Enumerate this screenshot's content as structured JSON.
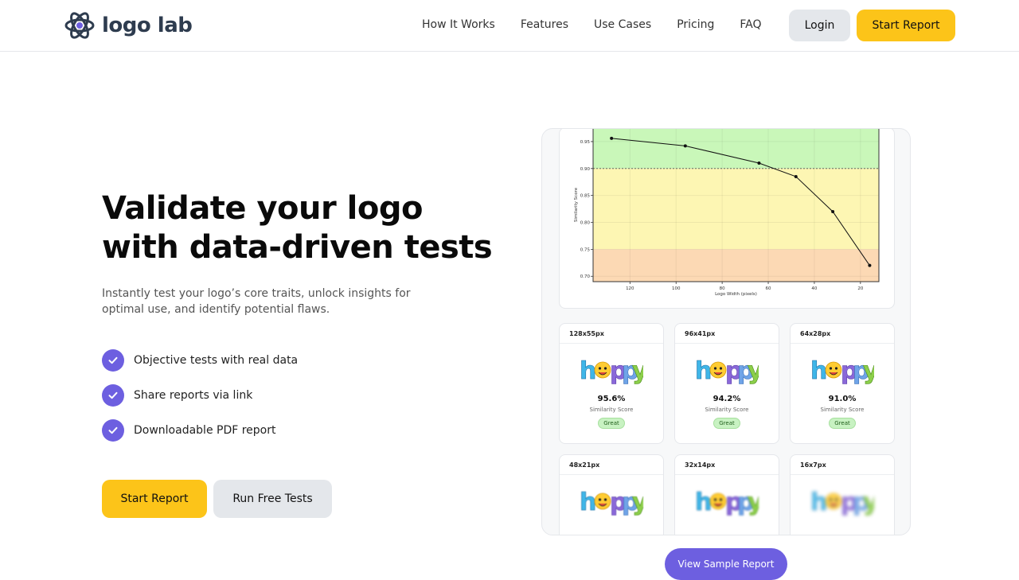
{
  "header": {
    "brand": "logo lab",
    "nav": [
      "How It Works",
      "Features",
      "Use Cases",
      "Pricing",
      "FAQ"
    ],
    "login_label": "Login",
    "start_label": "Start Report"
  },
  "hero": {
    "title_line1": "Validate your logo",
    "title_line2": "with data-driven tests",
    "subtitle": "Instantly test your logo’s core traits, unlock insights for optimal use, and identify potential flaws.",
    "features": [
      "Objective tests with real data",
      "Share reports via link",
      "Downloadable PDF report"
    ],
    "start_label": "Start Report",
    "run_label": "Run Free Tests"
  },
  "preview": {
    "sample_label": "View Sample Report",
    "logo_word": "happy",
    "cards": [
      {
        "size": "128x55px",
        "score": "95.6%",
        "score_label": "Similarity Score",
        "badge": "Great"
      },
      {
        "size": "96x41px",
        "score": "94.2%",
        "score_label": "Similarity Score",
        "badge": "Great"
      },
      {
        "size": "64x28px",
        "score": "91.0%",
        "score_label": "Similarity Score",
        "badge": "Great"
      },
      {
        "size": "48x21px",
        "score": "",
        "score_label": "",
        "badge": ""
      },
      {
        "size": "32x14px",
        "score": "",
        "score_label": "",
        "badge": ""
      },
      {
        "size": "16x7px",
        "score": "",
        "score_label": "",
        "badge": ""
      }
    ]
  },
  "colors": {
    "accent": "#6d5fe0",
    "cta": "#fcc419",
    "secondary": "#e4e7eb",
    "zone_green": "#c9f7b9",
    "zone_yellow": "#fdf6b3",
    "zone_orange": "#fcd9b4"
  },
  "chart_data": {
    "type": "line",
    "title": "",
    "xlabel": "Logo Width (pixels)",
    "ylabel": "Similarity Score",
    "x": [
      128,
      96,
      64,
      48,
      32,
      16
    ],
    "values": [
      0.956,
      0.942,
      0.91,
      0.885,
      0.82,
      0.72
    ],
    "x_ticks": [
      "120",
      "100",
      "80",
      "60",
      "40",
      "20"
    ],
    "y_ticks": [
      "0.95",
      "0.90",
      "0.85",
      "0.80",
      "0.75",
      "0.70"
    ],
    "xlim": [
      136,
      12
    ],
    "ylim": [
      0.69,
      0.975
    ],
    "zones": [
      {
        "from": 0.9,
        "to": 0.975,
        "color": "#c9f7b9"
      },
      {
        "from": 0.75,
        "to": 0.9,
        "color": "#fdf6b3"
      },
      {
        "from": 0.69,
        "to": 0.75,
        "color": "#fcd9b4"
      }
    ],
    "grid": true
  }
}
